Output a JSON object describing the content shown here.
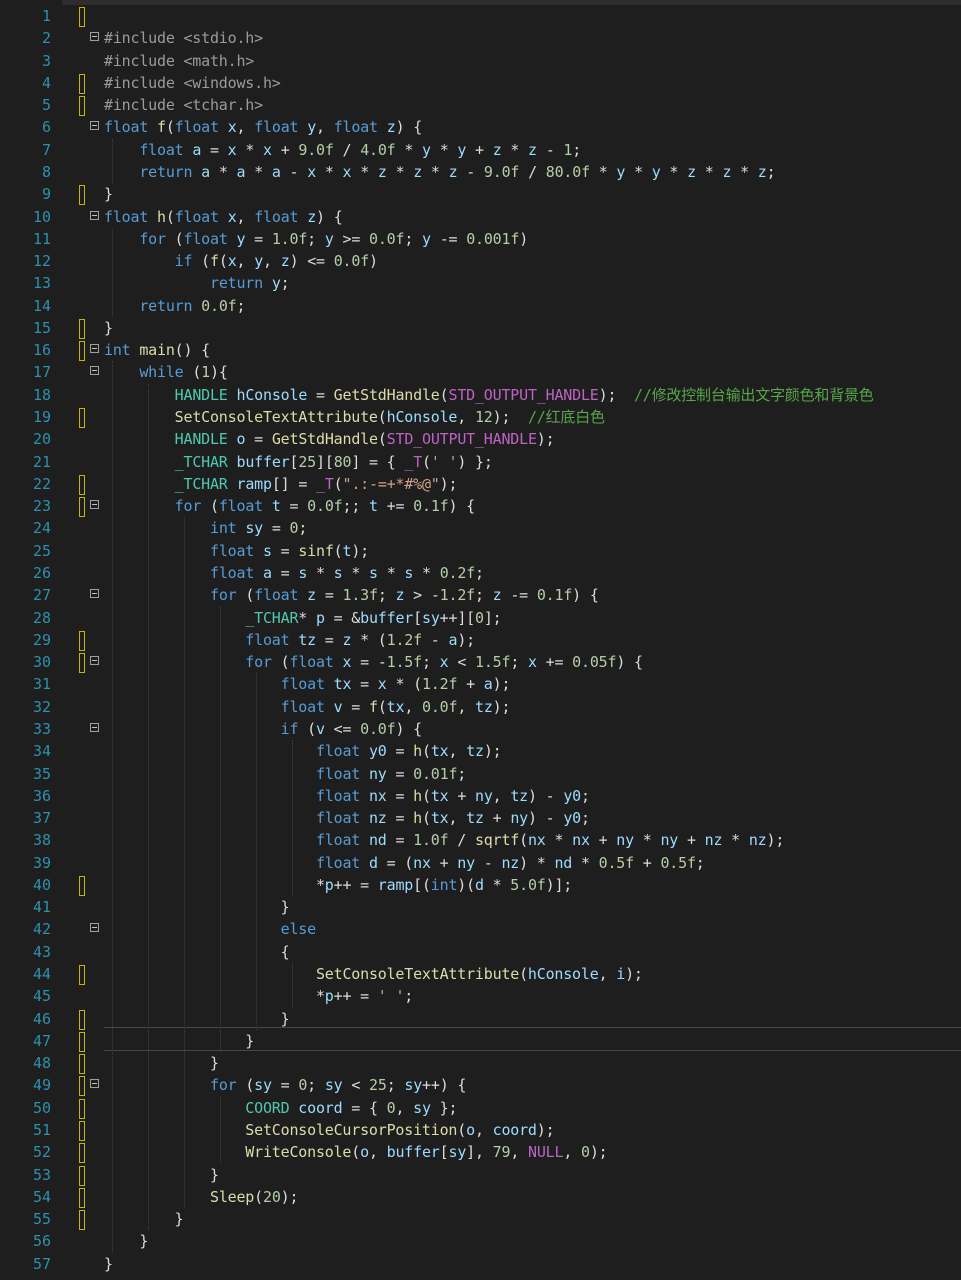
{
  "editor": {
    "lines": [
      {
        "n": "1",
        "text": ""
      },
      {
        "n": "2",
        "text": "#include <stdio.h>"
      },
      {
        "n": "3",
        "text": "#include <math.h>"
      },
      {
        "n": "4",
        "text": "#include <windows.h>"
      },
      {
        "n": "5",
        "text": "#include <tchar.h>"
      },
      {
        "n": "6",
        "text": "float f(float x, float y, float z) {"
      },
      {
        "n": "7",
        "text": "    float a = x * x + 9.0f / 4.0f * y * y + z * z - 1;"
      },
      {
        "n": "8",
        "text": "    return a * a * a - x * x * z * z * z - 9.0f / 80.0f * y * y * z * z * z;"
      },
      {
        "n": "9",
        "text": "}"
      },
      {
        "n": "10",
        "text": "float h(float x, float z) {"
      },
      {
        "n": "11",
        "text": "    for (float y = 1.0f; y >= 0.0f; y -= 0.001f)"
      },
      {
        "n": "12",
        "text": "        if (f(x, y, z) <= 0.0f)"
      },
      {
        "n": "13",
        "text": "            return y;"
      },
      {
        "n": "14",
        "text": "    return 0.0f;"
      },
      {
        "n": "15",
        "text": "}"
      },
      {
        "n": "16",
        "text": "int main() {"
      },
      {
        "n": "17",
        "text": "    while (1){"
      },
      {
        "n": "18",
        "text": "        HANDLE hConsole = GetStdHandle(STD_OUTPUT_HANDLE);  //修改控制台输出文字颜色和背景色"
      },
      {
        "n": "19",
        "text": "        SetConsoleTextAttribute(hConsole, 12);  //红底白色"
      },
      {
        "n": "20",
        "text": "        HANDLE o = GetStdHandle(STD_OUTPUT_HANDLE);"
      },
      {
        "n": "21",
        "text": "        _TCHAR buffer[25][80] = { _T(' ') };"
      },
      {
        "n": "22",
        "text": "        _TCHAR ramp[] = _T(\".:-=+*#%@\");"
      },
      {
        "n": "23",
        "text": "        for (float t = 0.0f;; t += 0.1f) {"
      },
      {
        "n": "24",
        "text": "            int sy = 0;"
      },
      {
        "n": "25",
        "text": "            float s = sinf(t);"
      },
      {
        "n": "26",
        "text": "            float a = s * s * s * s * 0.2f;"
      },
      {
        "n": "27",
        "text": "            for (float z = 1.3f; z > -1.2f; z -= 0.1f) {"
      },
      {
        "n": "28",
        "text": "                _TCHAR* p = &buffer[sy++][0];"
      },
      {
        "n": "29",
        "text": "                float tz = z * (1.2f - a);"
      },
      {
        "n": "30",
        "text": "                for (float x = -1.5f; x < 1.5f; x += 0.05f) {"
      },
      {
        "n": "31",
        "text": "                    float tx = x * (1.2f + a);"
      },
      {
        "n": "32",
        "text": "                    float v = f(tx, 0.0f, tz);"
      },
      {
        "n": "33",
        "text": "                    if (v <= 0.0f) {"
      },
      {
        "n": "34",
        "text": "                        float y0 = h(tx, tz);"
      },
      {
        "n": "35",
        "text": "                        float ny = 0.01f;"
      },
      {
        "n": "36",
        "text": "                        float nx = h(tx + ny, tz) - y0;"
      },
      {
        "n": "37",
        "text": "                        float nz = h(tx, tz + ny) - y0;"
      },
      {
        "n": "38",
        "text": "                        float nd = 1.0f / sqrtf(nx * nx + ny * ny + nz * nz);"
      },
      {
        "n": "39",
        "text": "                        float d = (nx + ny - nz) * nd * 0.5f + 0.5f;"
      },
      {
        "n": "40",
        "text": "                        *p++ = ramp[(int)(d * 5.0f)];"
      },
      {
        "n": "41",
        "text": "                    }"
      },
      {
        "n": "42",
        "text": "                    else"
      },
      {
        "n": "43",
        "text": "                    {"
      },
      {
        "n": "44",
        "text": "                        SetConsoleTextAttribute(hConsole, i);"
      },
      {
        "n": "45",
        "text": "                        *p++ = ' ';"
      },
      {
        "n": "46",
        "text": "                    }"
      },
      {
        "n": "47",
        "text": "                }"
      },
      {
        "n": "48",
        "text": "            }"
      },
      {
        "n": "49",
        "text": "            for (sy = 0; sy < 25; sy++) {"
      },
      {
        "n": "50",
        "text": "                COORD coord = { 0, sy };"
      },
      {
        "n": "51",
        "text": "                SetConsoleCursorPosition(o, coord);"
      },
      {
        "n": "52",
        "text": "                WriteConsole(o, buffer[sy], 79, NULL, 0);"
      },
      {
        "n": "53",
        "text": "            }"
      },
      {
        "n": "54",
        "text": "            Sleep(20);"
      },
      {
        "n": "55",
        "text": "        }"
      },
      {
        "n": "56",
        "text": "    }"
      },
      {
        "n": "57",
        "text": "}"
      }
    ]
  },
  "colors": {
    "background": "#1e1e1e",
    "line_number": "#2b91af",
    "keyword": "#569cd6",
    "comment": "#57a64a",
    "change_marker": "#c8b400"
  }
}
